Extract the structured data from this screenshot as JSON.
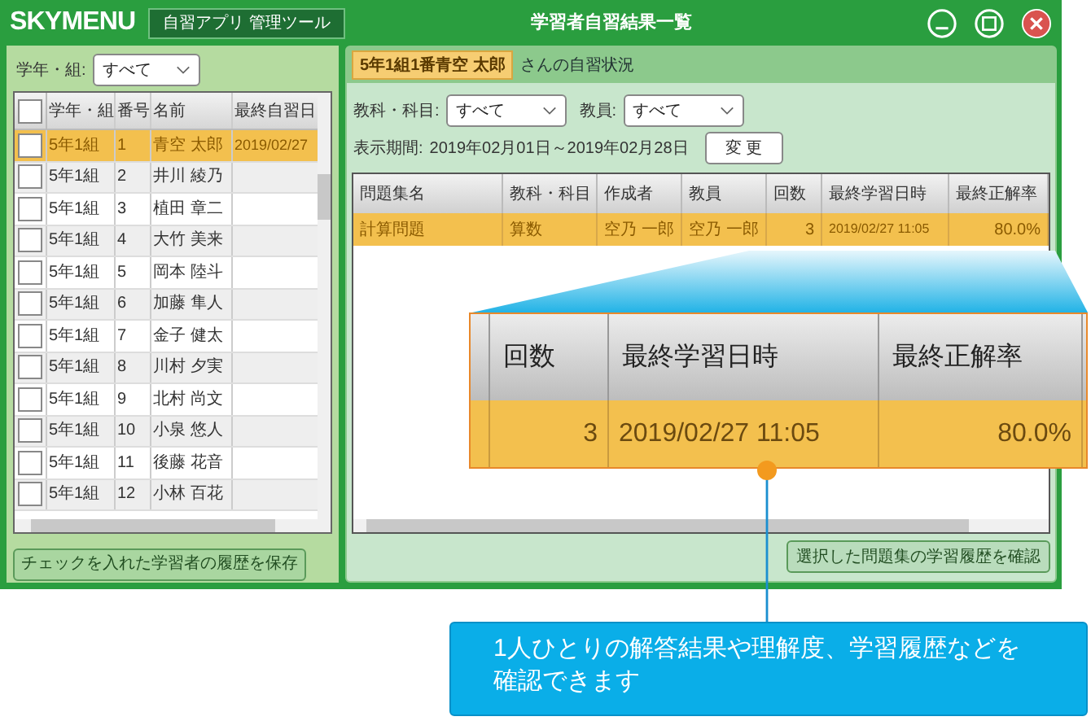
{
  "window": {
    "brand": "SKYMENU",
    "app_tag": "自習アプリ 管理ツール",
    "title": "学習者自習結果一覧"
  },
  "left": {
    "filter": {
      "label": "学年・組:",
      "value": "すべて"
    },
    "select_all": {
      "checked": false
    },
    "columns": [
      "学年・組",
      "番号",
      "名前",
      "最終自習日"
    ],
    "rows": [
      {
        "cells": [
          "5年1組",
          "1",
          "青空 太郎",
          "2019/02/27"
        ],
        "checked": false,
        "selected": true
      },
      {
        "cells": [
          "5年1組",
          "2",
          "井川 綾乃",
          ""
        ],
        "checked": false,
        "selected": false
      },
      {
        "cells": [
          "5年1組",
          "3",
          "植田 章二",
          ""
        ],
        "checked": false,
        "selected": false
      },
      {
        "cells": [
          "5年1組",
          "4",
          "大竹 美来",
          ""
        ],
        "checked": false,
        "selected": false
      },
      {
        "cells": [
          "5年1組",
          "5",
          "岡本 陸斗",
          ""
        ],
        "checked": false,
        "selected": false
      },
      {
        "cells": [
          "5年1組",
          "6",
          "加藤 隼人",
          ""
        ],
        "checked": false,
        "selected": false
      },
      {
        "cells": [
          "5年1組",
          "7",
          "金子 健太",
          ""
        ],
        "checked": false,
        "selected": false
      },
      {
        "cells": [
          "5年1組",
          "8",
          "川村 夕実",
          ""
        ],
        "checked": false,
        "selected": false
      },
      {
        "cells": [
          "5年1組",
          "9",
          "北村 尚文",
          ""
        ],
        "checked": false,
        "selected": false
      },
      {
        "cells": [
          "5年1組",
          "10",
          "小泉 悠人",
          ""
        ],
        "checked": false,
        "selected": false
      },
      {
        "cells": [
          "5年1組",
          "11",
          "後藤 花音",
          ""
        ],
        "checked": false,
        "selected": false
      },
      {
        "cells": [
          "5年1組",
          "12",
          "小林 百花",
          ""
        ],
        "checked": false,
        "selected": false
      }
    ],
    "save_button": "チェックを入れた学習者の履歴を保存"
  },
  "right": {
    "student": {
      "name": "5年1組1番青空 太郎",
      "suffix": "さんの自習状況"
    },
    "filters": [
      {
        "label": "教科・科目:",
        "value": "すべて"
      },
      {
        "label": "教員:",
        "value": "すべて"
      }
    ],
    "period": {
      "label": "表示期間:",
      "value": "2019年02月01日～2019年02月28日"
    },
    "change_button": "変 更",
    "columns": [
      "問題集名",
      "教科・科目",
      "作成者",
      "教員",
      "回数",
      "最終学習日時",
      "最終正解率"
    ],
    "rows": [
      {
        "cells": [
          "計算問題",
          "算数",
          "空乃 一郎",
          "空乃 一郎",
          "3",
          "2019/02/27 11:05",
          "80.0%"
        ],
        "selected": true
      }
    ],
    "confirm_button": "選択した問題集の学習履歴を確認"
  },
  "magnifier": {
    "columns": [
      "回数",
      "最終学習日時",
      "最終正解率"
    ],
    "row": [
      "3",
      "2019/02/27 11:05",
      "80.0%"
    ]
  },
  "callout": {
    "text": "1人ひとりの解答結果や理解度、学習履歴などを確認できます"
  }
}
